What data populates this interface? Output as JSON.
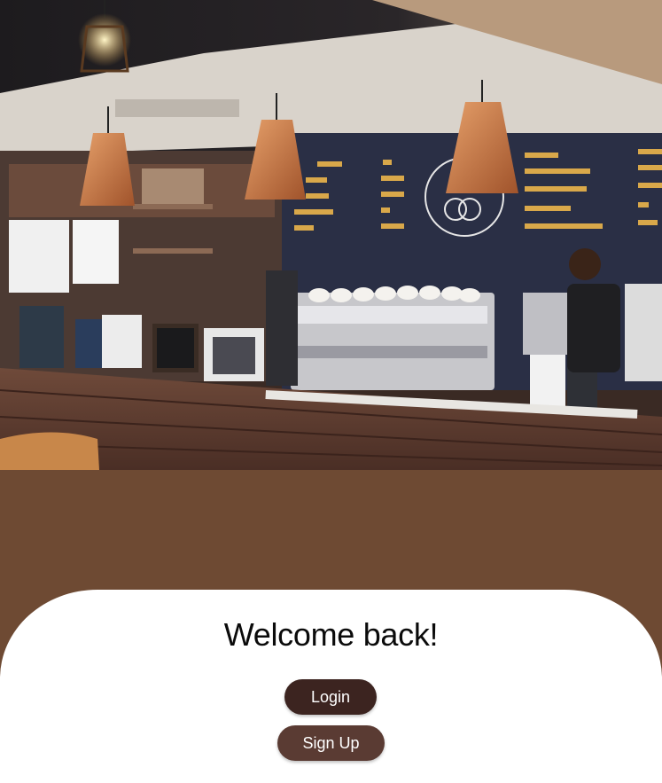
{
  "hero": {
    "image_description_icon": "coffee-shop-photo"
  },
  "welcome": {
    "title": "Welcome back!"
  },
  "actions": {
    "login_label": "Login",
    "signup_label": "Sign Up"
  },
  "colors": {
    "background": "#6e4a33",
    "sheet": "#ffffff",
    "login_button": "#3c2420",
    "signup_button": "#5a3b33"
  }
}
